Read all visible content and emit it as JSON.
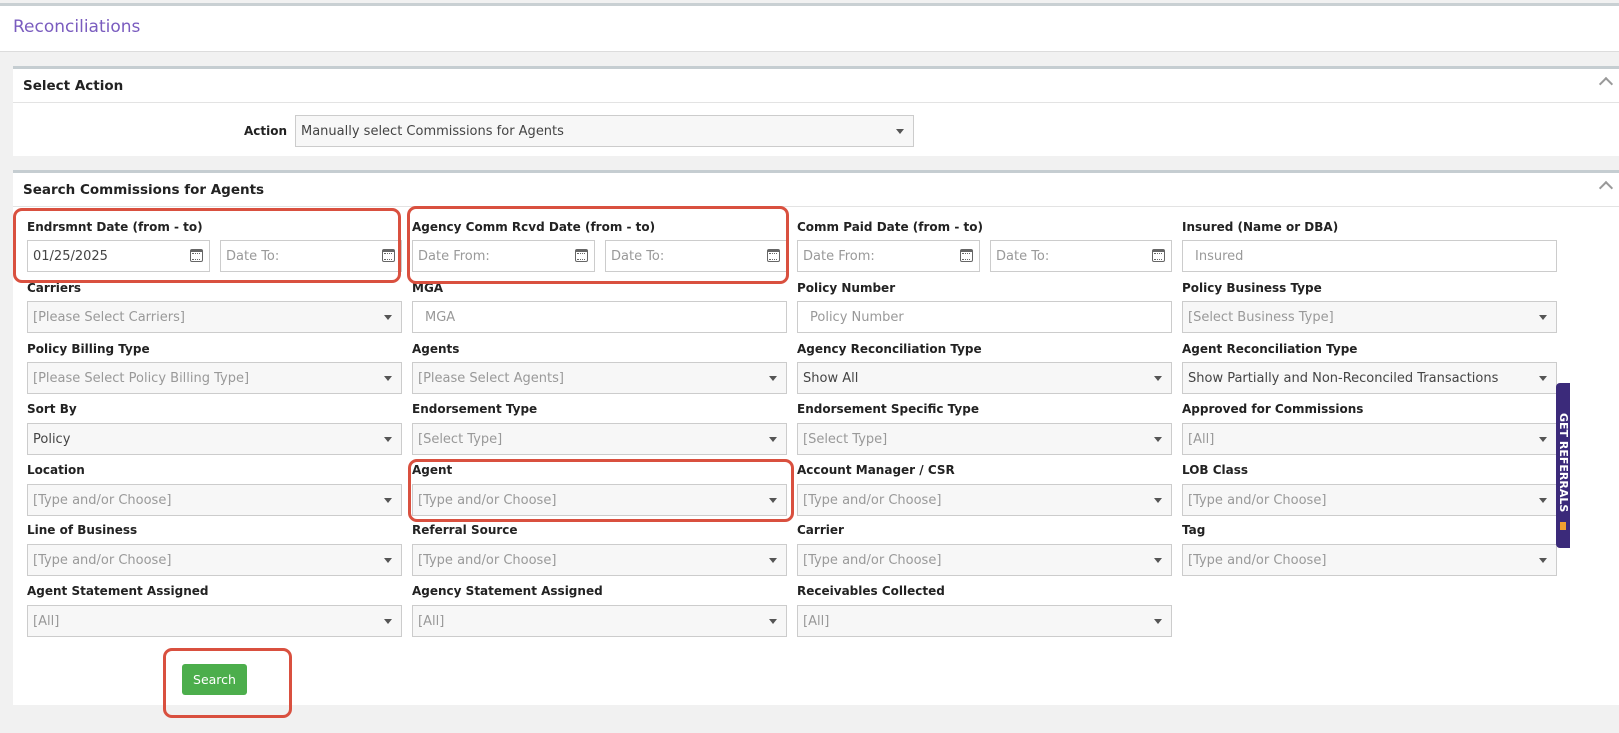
{
  "page": {
    "title": "Reconciliations"
  },
  "select_action": {
    "title": "Select Action",
    "action_label": "Action",
    "action_value": "Manually select Commissions for Agents"
  },
  "search": {
    "title": "Search Commissions for Agents",
    "endrsmnt_date": {
      "label": "Endrsmnt Date (from - to)",
      "from_value": "01/25/2025",
      "to_placeholder": "Date To:"
    },
    "agency_comm_rcvd_date": {
      "label": "Agency Comm Rcvd Date (from - to)",
      "from_placeholder": "Date From:",
      "to_placeholder": "Date To:"
    },
    "comm_paid_date": {
      "label": "Comm Paid Date (from - to)",
      "from_placeholder": "Date From:",
      "to_placeholder": "Date To:"
    },
    "insured": {
      "label": "Insured (Name or DBA)",
      "placeholder": "Insured"
    },
    "carriers": {
      "label": "Carriers",
      "value": "[Please Select Carriers]"
    },
    "mga": {
      "label": "MGA",
      "placeholder": "MGA"
    },
    "policy_number": {
      "label": "Policy Number",
      "placeholder": "Policy Number"
    },
    "policy_business_type": {
      "label": "Policy Business Type",
      "value": "[Select Business Type]"
    },
    "policy_billing_type": {
      "label": "Policy Billing Type",
      "value": "[Please Select Policy Billing Type]"
    },
    "agents": {
      "label": "Agents",
      "value": "[Please Select Agents]"
    },
    "agency_reconciliation_type": {
      "label": "Agency Reconciliation Type",
      "value": "Show All"
    },
    "agent_reconciliation_type": {
      "label": "Agent Reconciliation Type",
      "value": "Show Partially and Non-Reconciled Transactions"
    },
    "sort_by": {
      "label": "Sort By",
      "value": "Policy"
    },
    "endorsement_type": {
      "label": "Endorsement Type",
      "value": "[Select Type]"
    },
    "endorsement_specific_type": {
      "label": "Endorsement Specific Type",
      "value": "[Select Type]"
    },
    "approved_for_commissions": {
      "label": "Approved for Commissions",
      "value": "[All]"
    },
    "location": {
      "label": "Location",
      "value": "[Type and/or Choose]"
    },
    "agent": {
      "label": "Agent",
      "value": "[Type and/or Choose]"
    },
    "account_manager": {
      "label": "Account Manager / CSR",
      "value": "[Type and/or Choose]"
    },
    "lob_class": {
      "label": "LOB Class",
      "value": "[Type and/or Choose]"
    },
    "line_of_business": {
      "label": "Line of Business",
      "value": "[Type and/or Choose]"
    },
    "referral_source": {
      "label": "Referral Source",
      "value": "[Type and/or Choose]"
    },
    "carrier": {
      "label": "Carrier",
      "value": "[Type and/or Choose]"
    },
    "tag": {
      "label": "Tag",
      "value": "[Type and/or Choose]"
    },
    "agent_statement_assigned": {
      "label": "Agent Statement Assigned",
      "value": "[All]"
    },
    "agency_statement_assigned": {
      "label": "Agency Statement Assigned",
      "value": "[All]"
    },
    "receivables_collected": {
      "label": "Receivables Collected",
      "value": "[All]"
    },
    "search_button": "Search"
  },
  "side_tab": {
    "label": "GET REFERRALS"
  },
  "colors": {
    "title_purple": "#7a5cbf",
    "highlight_red": "#d9503f",
    "search_green": "#4cae4c"
  }
}
